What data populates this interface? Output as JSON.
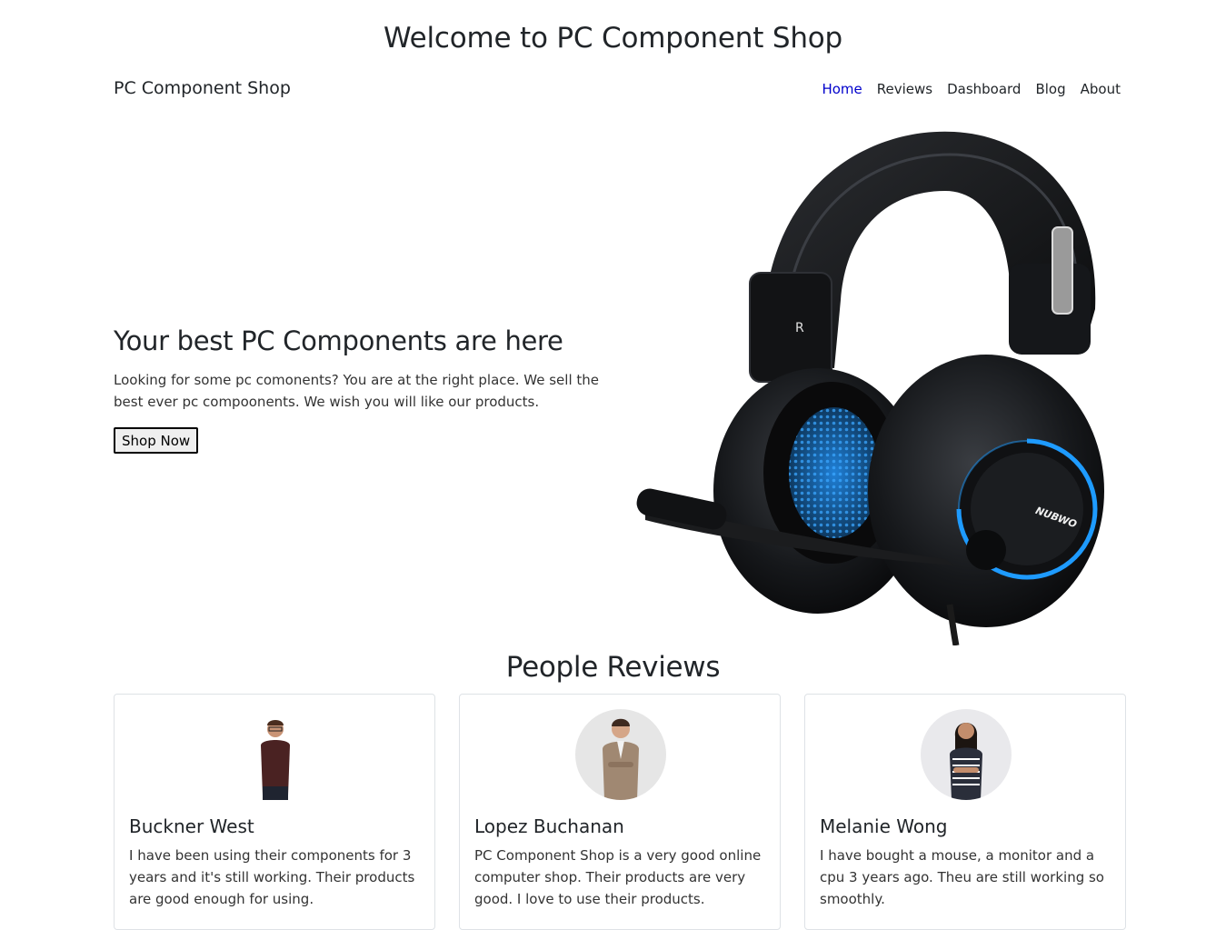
{
  "page": {
    "heading": "Welcome to PC Component Shop"
  },
  "navbar": {
    "brand": "PC Component Shop",
    "links": [
      {
        "label": "Home",
        "active": true
      },
      {
        "label": "Reviews",
        "active": false
      },
      {
        "label": "Dashboard",
        "active": false
      },
      {
        "label": "Blog",
        "active": false
      },
      {
        "label": "About",
        "active": false
      }
    ],
    "active_color": "#0000cc"
  },
  "hero": {
    "title": "Your best PC Components are here",
    "text": "Looking for some pc comonents? You are at the right place. We sell the best ever pc compoonents. We wish you will like our products.",
    "button_label": "Shop Now",
    "image": "headset-image",
    "headset_brand": "NUBWO",
    "headset_side": "R",
    "accent_color": "#1e9bff"
  },
  "reviews": {
    "heading": "People Reviews",
    "items": [
      {
        "name": "Buckner West",
        "text": "I have been using their components for 3 years and it's still working. Their products are good enough for using."
      },
      {
        "name": "Lopez Buchanan",
        "text": "PC Component Shop is a very good online computer shop. Their products are very good. I love to use their products."
      },
      {
        "name": "Melanie Wong",
        "text": "I have bought a mouse, a monitor and a cpu 3 years ago. Theu are still working so smoothly."
      }
    ]
  }
}
